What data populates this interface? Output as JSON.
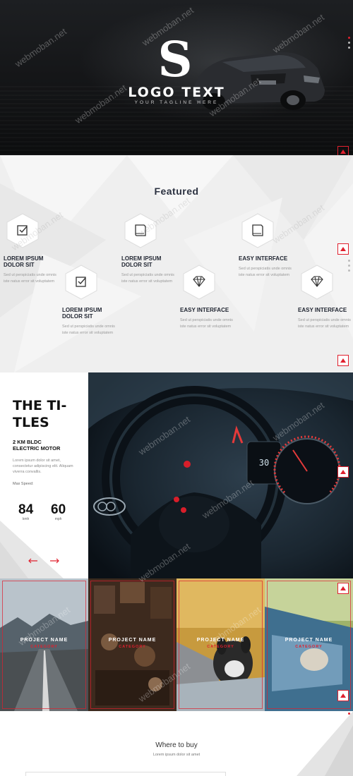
{
  "hero": {
    "logo_letter": "S",
    "logo_text": "LOGO TEXT",
    "tagline": "YOUR TAGLINE HERE"
  },
  "featured": {
    "title": "Featured",
    "items": [
      {
        "title_line1": "LOREM IPSUM",
        "title_line2": "DOLOR SIT",
        "desc": "Sed ut perspiciatis unde omnis iste natus error sit voluptatem",
        "icon": "check-icon"
      },
      {
        "title_line1": "LOREM IPSUM",
        "title_line2": "DOLOR SIT",
        "desc": "Sed ut perspiciatis unde omnis iste natus error sit voluptatem",
        "icon": "check-icon"
      },
      {
        "title_line1": "LOREM IPSUM",
        "title_line2": "DOLOR SIT",
        "desc": "Sed ut perspiciatis unde omnis iste natus error sit voluptatem",
        "icon": "book-icon"
      },
      {
        "title_line1": "EASY INTERFACE",
        "title_line2": "",
        "desc": "Sed ut perspiciatis unde omnis iste natus error sit voluptatem",
        "icon": "diamond-icon"
      },
      {
        "title_line1": "EASY INTERFACE",
        "title_line2": "",
        "desc": "Sed ut perspiciatis unde omnis iste natus error sit voluptatem",
        "icon": "book-icon"
      },
      {
        "title_line1": "EASY INTERFACE",
        "title_line2": "",
        "desc": "Sed ut perspiciatis unde omnis iste natus error sit voluptatem",
        "icon": "diamond-icon"
      }
    ]
  },
  "titles": {
    "big_title_line1": "THE TI-",
    "big_title_line2": "TLES",
    "sub_line1": "2 KM BLDC",
    "sub_line2": "ELECTRIC MOTOR",
    "body": "Lorem ipsum dolor sit amet, consectetur adipiscing elit. Aliquam viverra convallis.",
    "max_speed": "Max Speed:",
    "stat1_value": "84",
    "stat1_unit": "kmh",
    "stat2_value": "60",
    "stat2_unit": "mph"
  },
  "projects": [
    {
      "name": "PROJECT NAME",
      "category": "CATEGORY"
    },
    {
      "name": "PROJECT NAME",
      "category": "CATEGORY"
    },
    {
      "name": "PROJECT NAME",
      "category": "CATEGORY"
    },
    {
      "name": "PROJECT NAME",
      "category": "CATEGORY"
    }
  ],
  "buy": {
    "title": "Where to buy",
    "subtitle": "Lorem ipsum dolor sit amet"
  },
  "watermark": "webmoban.net",
  "colors": {
    "accent": "#e0202e",
    "dark": "#111111",
    "heading": "#2b3140"
  }
}
